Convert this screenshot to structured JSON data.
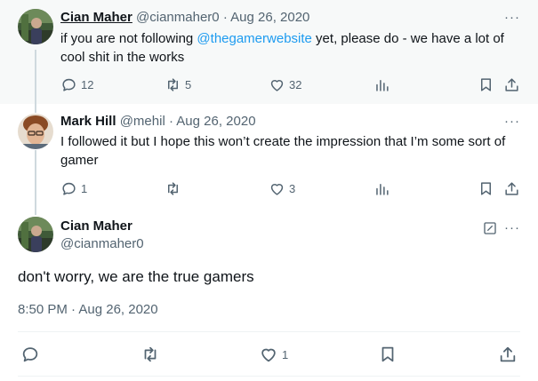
{
  "tweets": [
    {
      "author_name": "Cian Maher",
      "handle": "@cianmaher0",
      "separator": "·",
      "date": "Aug 26, 2020",
      "text_before": "if you are not following ",
      "mention": "@thegamerwebsite",
      "text_after": " yet, please do - we have a lot of cool shit in the works",
      "replies": "12",
      "retweets": "5",
      "likes": "32",
      "more_label": "···"
    },
    {
      "author_name": "Mark Hill",
      "handle": "@mehil",
      "separator": "·",
      "date": "Aug 26, 2020",
      "text": "I followed it but I hope this won’t create the impression that I’m some sort of gamer",
      "replies": "1",
      "retweets": "",
      "likes": "3",
      "more_label": "···"
    }
  ],
  "main_tweet": {
    "author_name": "Cian Maher",
    "handle": "@cianmaher0",
    "text": "don't worry, we are the true gamers",
    "timestamp": "8:50 PM · Aug 26, 2020",
    "likes": "1",
    "more_label": "···"
  },
  "colors": {
    "accent": "#1d9bf0",
    "muted": "#536471",
    "thread_bg": "#f7f9f9"
  }
}
